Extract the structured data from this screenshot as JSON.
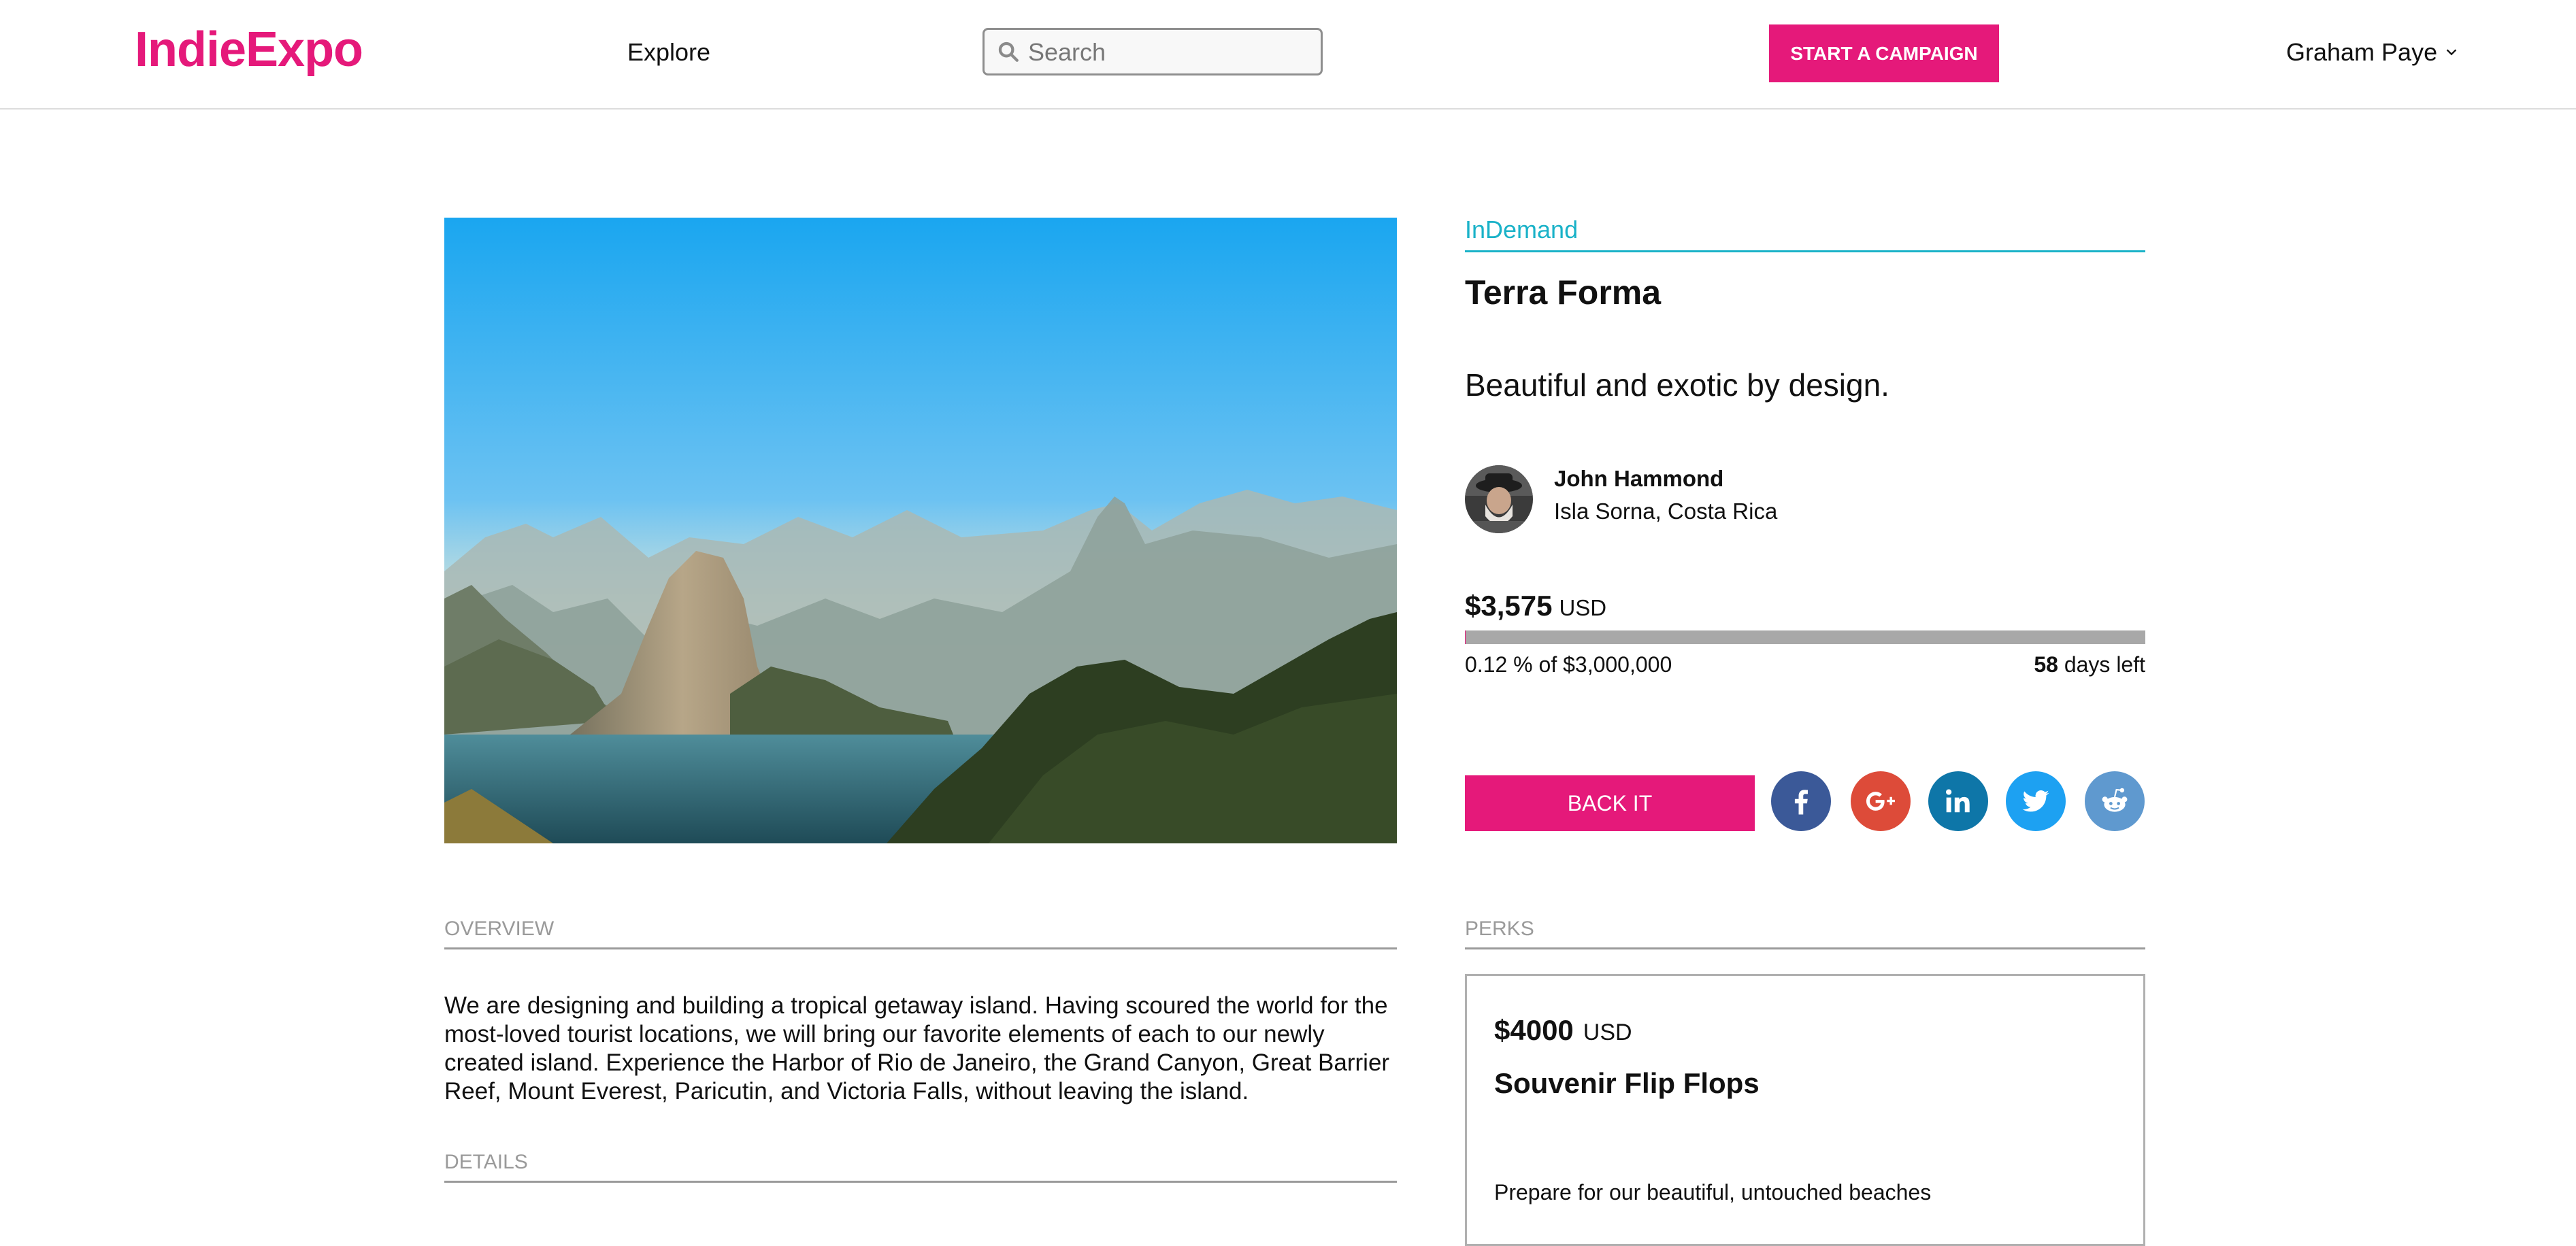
{
  "page": {
    "title": ""
  },
  "colors": {
    "brand": "#e5197a",
    "accent": "#1ab2c8",
    "progress_track": "#a8a8a8",
    "facebook": "#3b5998",
    "google_plus": "#dd4b39",
    "linkedin": "#0e76a8",
    "twitter": "#1da1f2",
    "reddit": "#5f99cf"
  },
  "header": {
    "logo": "IndieExpo",
    "nav_explore": "Explore",
    "search": {
      "placeholder": "Search",
      "value": "",
      "icon": "search-icon"
    },
    "start_campaign_label": "START A CAMPAIGN",
    "user_name": "Graham Paye",
    "user_menu_icon": "chevron-down-icon"
  },
  "campaign": {
    "category": "InDemand",
    "title": "Terra Forma",
    "tagline": "Beautiful and exotic by design.",
    "creator": {
      "name": "John Hammond",
      "location": "Isla Sorna, Costa Rica"
    },
    "raised_amount": "$3,575",
    "raised_currency": "USD",
    "progress_fraction": 0.0012,
    "progress_text": "0.12 % of $3,000,000",
    "days_left": "58",
    "days_left_label": "days left",
    "back_label": "BACK IT",
    "share_icons": [
      "facebook-icon",
      "google-plus-icon",
      "linkedin-icon",
      "twitter-icon",
      "reddit-icon"
    ]
  },
  "sections": {
    "overview_label": "OVERVIEW",
    "overview_text": "We are designing and building a tropical getaway island. Having scoured the world for the most-loved tourist locations, we will bring our favorite elements of each to our newly created island. Experience the Harbor of Rio de Janeiro, the Grand Canyon, Great Barrier Reef, Mount Everest, Paricutin, and Victoria Falls, without leaving the island.",
    "details_label": "DETAILS",
    "perks_label": "PERKS"
  },
  "perk": {
    "amount": "$4000",
    "currency": "USD",
    "title": "Souvenir Flip Flops",
    "description": "Prepare for our beautiful, untouched beaches"
  }
}
